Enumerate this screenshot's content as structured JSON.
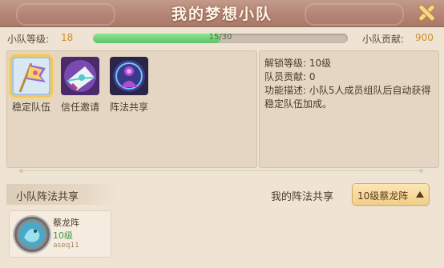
{
  "title": "我的梦想小队",
  "team_level": {
    "label": "小队等级:",
    "value": "18"
  },
  "progress": {
    "text": "15/30",
    "fraction": 0.5
  },
  "contribution": {
    "label": "小队贡献:",
    "value": "900"
  },
  "skills": [
    {
      "name": "稳定队伍",
      "icon": "flag-icon",
      "selected": true
    },
    {
      "name": "信任邀请",
      "icon": "letter-icon",
      "selected": false
    },
    {
      "name": "阵法共享",
      "icon": "formation-icon",
      "selected": false
    }
  ],
  "info": {
    "unlock": "解锁等级: 10级",
    "member_contrib": "队员贡献: 0",
    "desc": "功能描述: 小队5人成员组队后自动获得稳定队伍加成。"
  },
  "section": {
    "title": "小队阵法共享",
    "my_label": "我的阵法共享",
    "my_button": "10级蔡龙阵"
  },
  "members": [
    {
      "formation": "蔡龙阵",
      "level": "10级",
      "player": "aseq11"
    }
  ],
  "colors": {
    "accent": "#d08c2a",
    "progress": "#6fd37a",
    "level_green": "#3e9a3e"
  }
}
